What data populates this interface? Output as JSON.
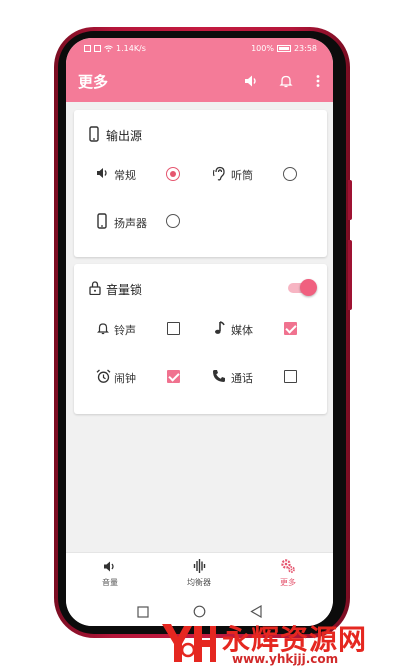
{
  "status_bar": {
    "speed": "1.14K/s",
    "battery": "100%",
    "time": "23:58"
  },
  "app_bar": {
    "title": "更多",
    "icons": [
      "volume-icon",
      "bell-icon",
      "more-vert-icon"
    ]
  },
  "output_source": {
    "title": "输出源",
    "icon": "phone-icon",
    "options": [
      {
        "label": "常规",
        "icon": "speaker-icon",
        "selected": true
      },
      {
        "label": "听筒",
        "icon": "ear-icon",
        "selected": false
      },
      {
        "label": "扬声器",
        "icon": "phone-icon",
        "selected": false
      }
    ]
  },
  "volume_lock": {
    "title": "音量锁",
    "icon": "lock-icon",
    "enabled": true,
    "options": [
      {
        "label": "铃声",
        "icon": "bell-icon",
        "checked": false
      },
      {
        "label": "媒体",
        "icon": "music-note-icon",
        "checked": true
      },
      {
        "label": "闹钟",
        "icon": "alarm-icon",
        "checked": true
      },
      {
        "label": "通话",
        "icon": "phone-call-icon",
        "checked": false
      }
    ]
  },
  "bottom_nav": {
    "items": [
      {
        "label": "音量",
        "icon": "volume-icon",
        "active": false
      },
      {
        "label": "均衡器",
        "icon": "equalizer-icon",
        "active": false
      },
      {
        "label": "更多",
        "icon": "gears-icon",
        "active": true
      }
    ]
  },
  "colors": {
    "accent": "#f47b98",
    "selected": "#e5566f",
    "phone_frame": "#c41b40"
  },
  "watermark": {
    "title": "永辉资源网",
    "url": "www.yhkjjj.com"
  }
}
